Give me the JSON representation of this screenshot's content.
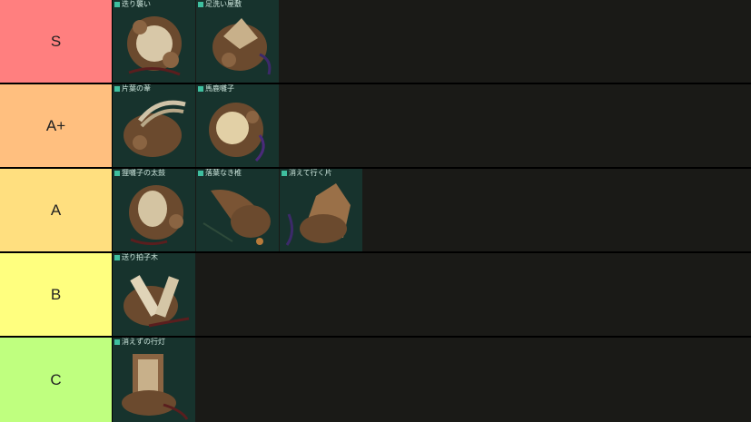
{
  "tiers": [
    {
      "label": "S",
      "color": "#ff7f7f",
      "items": [
        {
          "caption": "迭り襲い"
        },
        {
          "caption": "足洗い屋敷"
        }
      ]
    },
    {
      "label": "A+",
      "color": "#ffbf7f",
      "items": [
        {
          "caption": "片葉の葦"
        },
        {
          "caption": "馬鹿囃子"
        }
      ]
    },
    {
      "label": "A",
      "color": "#ffdf7f",
      "items": [
        {
          "caption": "狸囃子の太鼓"
        },
        {
          "caption": "落葉なき椎"
        },
        {
          "caption": "消えて行く片"
        }
      ]
    },
    {
      "label": "B",
      "color": "#ffff7f",
      "items": [
        {
          "caption": "送り拍子木"
        }
      ]
    },
    {
      "label": "C",
      "color": "#bfff7f",
      "items": [
        {
          "caption": "消えずの行灯"
        }
      ]
    }
  ]
}
